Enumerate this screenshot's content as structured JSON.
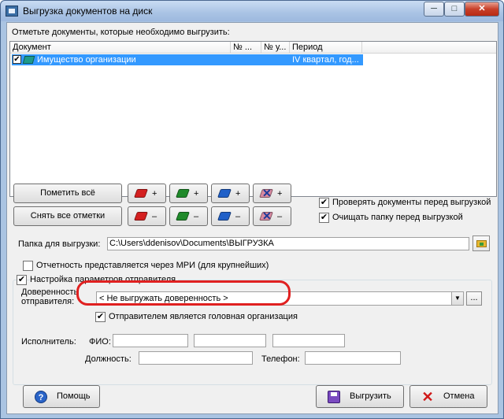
{
  "window": {
    "title": "Выгрузка документов на диск",
    "min_glyph": "─",
    "max_glyph": "□",
    "close_glyph": "✕"
  },
  "list": {
    "instruction": "Отметьте документы, которые необходимо выгрузить:",
    "columns": [
      "Документ",
      "№ ...",
      "№ у...",
      "Период"
    ],
    "rows": [
      {
        "checked": "✔",
        "document": "Имущество организации",
        "period": "IV квартал, год..."
      }
    ]
  },
  "actions": {
    "mark_all": "Пометить всё",
    "unmark_all": "Снять все отметки",
    "plus": "+",
    "minus": "–",
    "x_glyph": "✕"
  },
  "options": {
    "verify_docs": {
      "label": "Проверять документы перед выгрузкой",
      "checked": "✔"
    },
    "clear_folder": {
      "label": "Очищать папку перед выгрузкой",
      "checked": "✔"
    },
    "mri": {
      "label": "Отчетность представляется через МРИ (для крупнейших)",
      "checked": ""
    }
  },
  "folder": {
    "label": "Папка для выгрузки:",
    "value": "C:\\Users\\ddenisov\\Documents\\ВЫГРУЗКА"
  },
  "sender": {
    "group_label": "Настройка параметров отправителя",
    "group_checked": "✔",
    "proxy_label_1": "Доверенность",
    "proxy_label_2": "отправителя:",
    "proxy_value": "< Не выгружать доверенность >",
    "dropdown_glyph": "▼",
    "dots": "...",
    "head_org": {
      "label": "Отправителем является головная организация",
      "checked": "✔"
    },
    "executor_label": "Исполнитель:",
    "fio_label": "ФИО:",
    "position_label": "Должность:",
    "phone_label": "Телефон:"
  },
  "footer": {
    "help": "Помощь",
    "help_glyph": "?",
    "export": "Выгрузить",
    "cancel": "Отмена",
    "cancel_glyph": "✕"
  }
}
